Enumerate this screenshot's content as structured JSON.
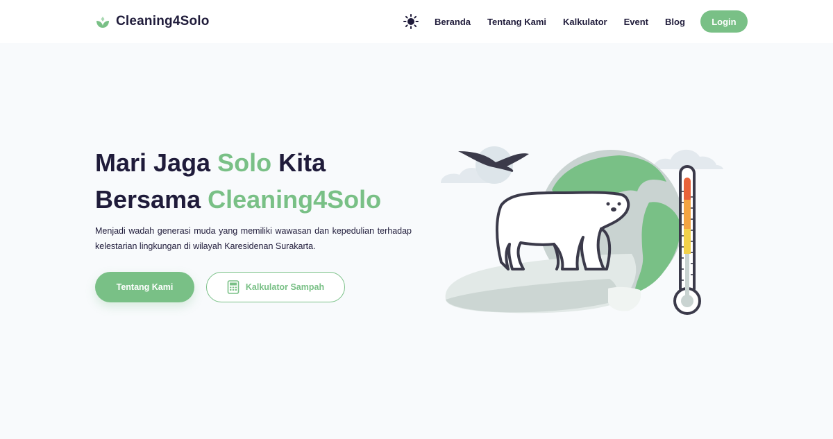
{
  "brand": {
    "name": "Cleaning4Solo",
    "icon": "leaf-logo-icon"
  },
  "nav": {
    "theme_icon": "sun-icon",
    "links": [
      "Beranda",
      "Tentang Kami",
      "Kalkulator",
      "Event",
      "Blog"
    ],
    "login_label": "Login"
  },
  "hero": {
    "title_line1_part1": "Mari Jaga ",
    "title_line1_accent": "Solo",
    "title_line1_part2": " Kita",
    "title_line2_part1": "Bersama ",
    "title_line2_accent": "Cleaning4Solo",
    "description": "Menjadi wadah generasi muda yang memiliki wawasan dan kepedulian terhadap kelestarian lingkungan di wilayah Karesidenan Surakarta.",
    "primary_button": "Tentang Kami",
    "secondary_button": "Kalkulator Sampah",
    "secondary_icon": "calculator-icon"
  },
  "colors": {
    "accent": "#79c086",
    "dark": "#1f1b3a",
    "background": "#f8fafc"
  },
  "illustration": {
    "subject": "polar-bear-globe-thermometer"
  }
}
